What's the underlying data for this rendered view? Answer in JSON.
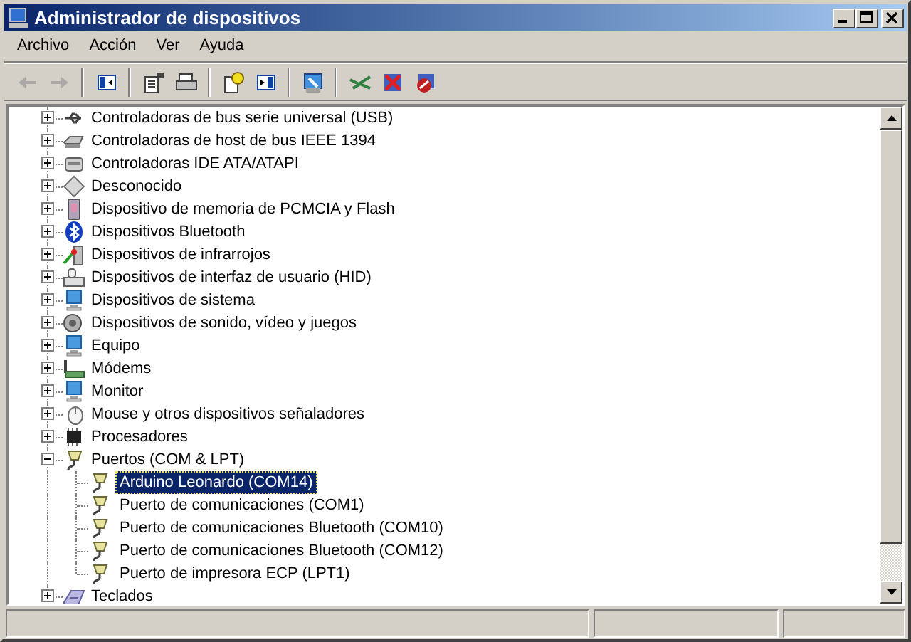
{
  "window": {
    "title": "Administrador de dispositivos"
  },
  "menu": [
    {
      "label": "Archivo"
    },
    {
      "label": "Acción"
    },
    {
      "label": "Ver"
    },
    {
      "label": "Ayuda"
    }
  ],
  "toolbar_groups": [
    [
      {
        "disabled": true
      },
      {
        "disabled": true
      }
    ],
    [
      {
        "disabled": false
      }
    ],
    [
      {
        "disabled": false
      },
      {
        "disabled": false
      }
    ],
    [
      {
        "disabled": false
      },
      {
        "disabled": false
      }
    ],
    [
      {
        "disabled": false
      }
    ],
    [
      {
        "disabled": false
      },
      {
        "disabled": false
      },
      {
        "disabled": false
      }
    ]
  ],
  "tree": [
    {
      "label": "Controladoras de bus serie universal (USB)",
      "expanded": false
    },
    {
      "label": "Controladoras de host de bus IEEE 1394",
      "expanded": false
    },
    {
      "label": "Controladoras IDE ATA/ATAPI",
      "expanded": false
    },
    {
      "label": "Desconocido",
      "expanded": false
    },
    {
      "label": "Dispositivo de memoria de PCMCIA y Flash",
      "expanded": false
    },
    {
      "label": "Dispositivos Bluetooth",
      "expanded": false
    },
    {
      "label": "Dispositivos de infrarrojos",
      "expanded": false
    },
    {
      "label": "Dispositivos de interfaz de usuario (HID)",
      "expanded": false
    },
    {
      "label": "Dispositivos de sistema",
      "expanded": false
    },
    {
      "label": "Dispositivos de sonido, vídeo y juegos",
      "expanded": false
    },
    {
      "label": "Equipo",
      "expanded": false
    },
    {
      "label": "Módems",
      "expanded": false
    },
    {
      "label": "Monitor",
      "expanded": false
    },
    {
      "label": "Mouse y otros dispositivos señaladores",
      "expanded": false
    },
    {
      "label": "Procesadores",
      "expanded": false
    },
    {
      "label": "Puertos (COM & LPT)",
      "expanded": true,
      "children": [
        {
          "label": "Arduino Leonardo (COM14)",
          "selected": true
        },
        {
          "label": "Puerto de comunicaciones (COM1)",
          "selected": false
        },
        {
          "label": "Puerto de comunicaciones Bluetooth (COM10)",
          "selected": false
        },
        {
          "label": "Puerto de comunicaciones Bluetooth (COM12)",
          "selected": false
        },
        {
          "label": "Puerto de impresora ECP (LPT1)",
          "selected": false
        }
      ]
    },
    {
      "label": "Teclados",
      "expanded": false
    }
  ]
}
